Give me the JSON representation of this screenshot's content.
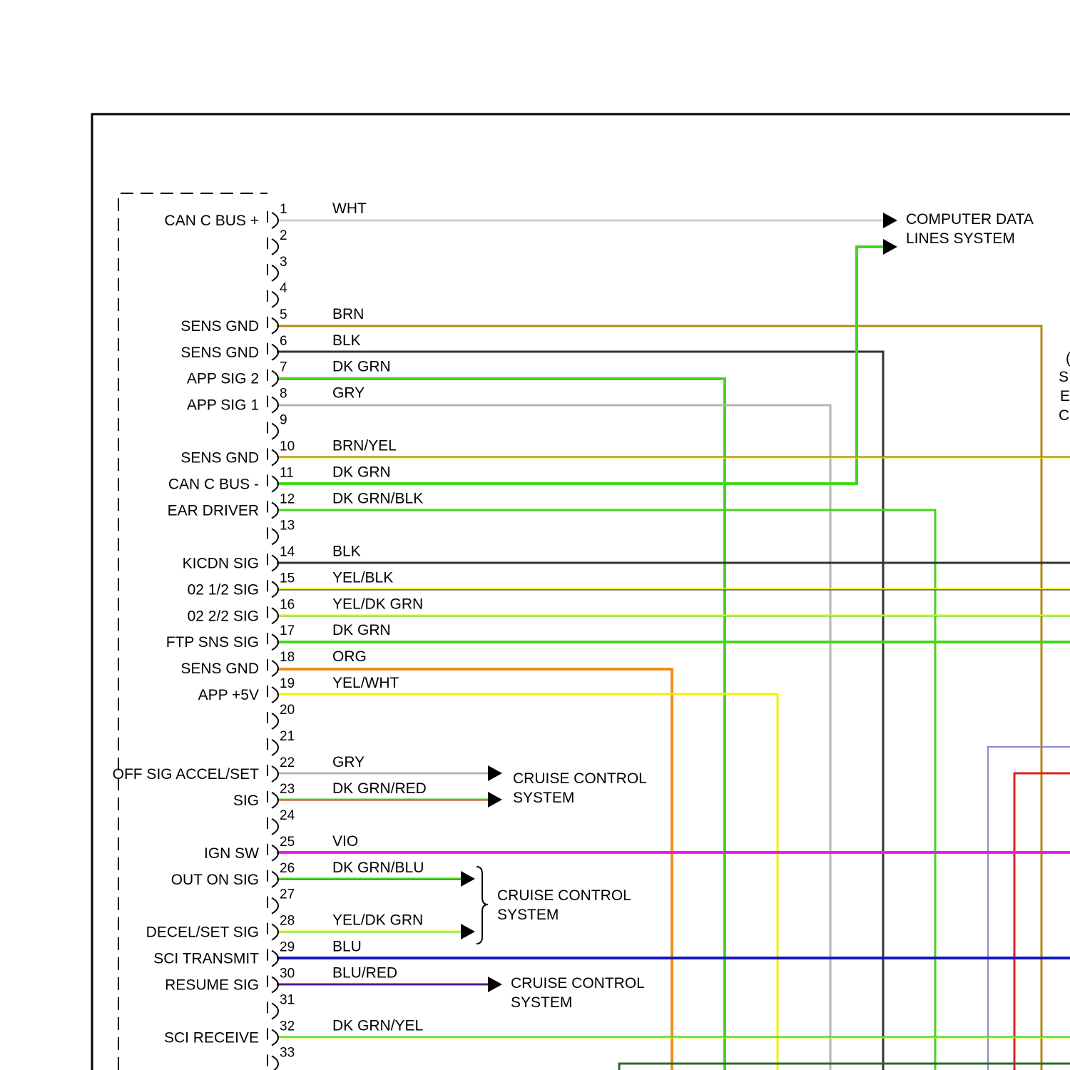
{
  "pins": [
    {
      "n": "1",
      "label": "CAN C BUS +",
      "color": "WHT",
      "hex": "#cfcfcf",
      "stripe": null
    },
    {
      "n": "2",
      "label": "",
      "color": "",
      "hex": null,
      "stripe": null
    },
    {
      "n": "3",
      "label": "",
      "color": "",
      "hex": null,
      "stripe": null
    },
    {
      "n": "4",
      "label": "",
      "color": "",
      "hex": null,
      "stripe": null
    },
    {
      "n": "5",
      "label": "SENS GND",
      "color": "BRN",
      "hex": "#b08a10",
      "stripe": null
    },
    {
      "n": "6",
      "label": "SENS GND",
      "color": "BLK",
      "hex": "#333333",
      "stripe": null
    },
    {
      "n": "7",
      "label": "APP SIG 2",
      "color": "DK GRN",
      "hex": "#44d61a",
      "stripe": null
    },
    {
      "n": "8",
      "label": "APP SIG 1",
      "color": "GRY",
      "hex": "#b4b4b4",
      "stripe": null
    },
    {
      "n": "9",
      "label": "",
      "color": "",
      "hex": null,
      "stripe": null
    },
    {
      "n": "10",
      "label": "SENS GND",
      "color": "BRN/YEL",
      "hex": "#b08a10",
      "stripe": "#f0f000"
    },
    {
      "n": "11",
      "label": "CAN C BUS -",
      "color": "DK GRN",
      "hex": "#44d61a",
      "stripe": null
    },
    {
      "n": "12",
      "label": "EAR DRIVER",
      "color": "DK GRN/BLK",
      "hex": "#44d61a",
      "stripe": "#222222"
    },
    {
      "n": "13",
      "label": "",
      "color": "",
      "hex": null,
      "stripe": null
    },
    {
      "n": "14",
      "label": "KICDN SIG",
      "color": "BLK",
      "hex": "#333333",
      "stripe": null
    },
    {
      "n": "15",
      "label": "02 1/2 SIG",
      "color": "YEL/BLK",
      "hex": "#f0f000",
      "stripe": "#222222"
    },
    {
      "n": "16",
      "label": "02 2/2 SIG",
      "color": "YEL/DK GRN",
      "hex": "#f0f000",
      "stripe": "#44d61a"
    },
    {
      "n": "17",
      "label": "FTP SNS SIG",
      "color": "DK GRN",
      "hex": "#44d61a",
      "stripe": null
    },
    {
      "n": "18",
      "label": "SENS GND",
      "color": "ORG",
      "hex": "#f08c1e",
      "stripe": null
    },
    {
      "n": "19",
      "label": "APP +5V",
      "color": "YEL/WHT",
      "hex": "#f0f000",
      "stripe": "#f8f8c8"
    },
    {
      "n": "20",
      "label": "",
      "color": "",
      "hex": null,
      "stripe": null
    },
    {
      "n": "21",
      "label": "",
      "color": "",
      "hex": null,
      "stripe": null
    },
    {
      "n": "22",
      "label": "OFF SIG ACCEL/SET",
      "color": "GRY",
      "hex": "#b4b4b4",
      "stripe": null
    },
    {
      "n": "23",
      "label": "SIG",
      "color": "DK GRN/RED",
      "hex": "#44d61a",
      "stripe": "#e02020"
    },
    {
      "n": "24",
      "label": "",
      "color": "",
      "hex": null,
      "stripe": null
    },
    {
      "n": "25",
      "label": "IGN SW",
      "color": "VIO",
      "hex": "#e81ee8",
      "stripe": null
    },
    {
      "n": "26",
      "label": "OUT ON SIG",
      "color": "DK GRN/BLU",
      "hex": "#44d61a",
      "stripe": "#2030c0"
    },
    {
      "n": "27",
      "label": "",
      "color": "",
      "hex": null,
      "stripe": null
    },
    {
      "n": "28",
      "label": "DECEL/SET SIG",
      "color": "YEL/DK GRN",
      "hex": "#f0f000",
      "stripe": "#44d61a"
    },
    {
      "n": "29",
      "label": "SCI TRANSMIT",
      "color": "BLU",
      "hex": "#1414c8",
      "stripe": null
    },
    {
      "n": "30",
      "label": "RESUME SIG",
      "color": "BLU/RED",
      "hex": "#1414c8",
      "stripe": "#e02020"
    },
    {
      "n": "31",
      "label": "",
      "color": "",
      "hex": null,
      "stripe": null
    },
    {
      "n": "32",
      "label": "SCI RECEIVE",
      "color": "DK GRN/YEL",
      "hex": "#44d61a",
      "stripe": "#f0f000"
    },
    {
      "n": "33",
      "label": "",
      "color": "",
      "hex": null,
      "stripe": null
    }
  ],
  "destinations": {
    "data_lines": [
      "COMPUTER DATA",
      "LINES SYSTEM"
    ],
    "cruise_a": [
      "CRUISE CONTROL",
      "SYSTEM"
    ],
    "cruise_b": [
      "CRUISE CONTROL",
      "SYSTEM"
    ],
    "cruise_c": [
      "CRUISE CONTROL",
      "SYSTEM"
    ]
  },
  "edge_fragments": [
    "(",
    "S",
    "E",
    "C"
  ]
}
